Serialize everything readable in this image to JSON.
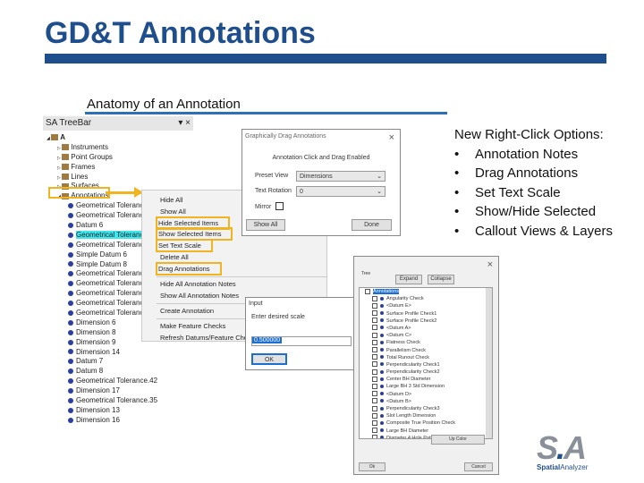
{
  "slide": {
    "title": "GD&T Annotations",
    "subtitle": "Anatomy of an Annotation",
    "notes_heading": "New Right-Click Options:",
    "notes": [
      "Annotation Notes",
      "Drag Annotations",
      "Set Text Scale",
      "Show/Hide Selected",
      "Callout Views & Layers"
    ],
    "accent": "#1f4e8c",
    "highlight": "#f0b420"
  },
  "treebar": {
    "title": "SA TreeBar",
    "pin": "▾ ×",
    "items": [
      {
        "label": "A",
        "level": 0,
        "icon": "folder-icon"
      },
      {
        "label": "Instruments",
        "level": 1,
        "icon": "instrument-icon"
      },
      {
        "label": "Point Groups",
        "level": 1,
        "icon": "point-group-icon"
      },
      {
        "label": "Frames",
        "level": 1,
        "icon": "frame-icon"
      },
      {
        "label": "Lines",
        "level": 1,
        "icon": "line-icon"
      },
      {
        "label": "Surfaces",
        "level": 1,
        "icon": "surface-icon"
      },
      {
        "label": "Annotations",
        "level": 1,
        "icon": "annotation-icon"
      },
      {
        "label": "Geometrical Tolerance.",
        "level": 2
      },
      {
        "label": "Geometrical Tolerance.",
        "level": 2
      },
      {
        "label": "Datum 6",
        "level": 2
      },
      {
        "label": "Geometrical Tolerance.",
        "level": 2,
        "selected": true
      },
      {
        "label": "Geometrical Tolerance.",
        "level": 2
      },
      {
        "label": "Simple Datum 6",
        "level": 2
      },
      {
        "label": "Simple Datum 8",
        "level": 2
      },
      {
        "label": "Geometrical Tolerance.",
        "level": 2
      },
      {
        "label": "Geometrical Tolerance.",
        "level": 2
      },
      {
        "label": "Geometrical Tolerance.",
        "level": 2
      },
      {
        "label": "Geometrical Tolerance.",
        "level": 2
      },
      {
        "label": "Geometrical Tolerance.",
        "level": 2
      },
      {
        "label": "Dimension 6",
        "level": 2
      },
      {
        "label": "Dimension 8",
        "level": 2
      },
      {
        "label": "Dimension 9",
        "level": 2
      },
      {
        "label": "Dimension 14",
        "level": 2
      },
      {
        "label": "Datum 7",
        "level": 2
      },
      {
        "label": "Datum 8",
        "level": 2
      },
      {
        "label": "Geometrical Tolerance.42",
        "level": 2
      },
      {
        "label": "Dimension 17",
        "level": 2
      },
      {
        "label": "Geometrical Tolerance.35",
        "level": 2
      },
      {
        "label": "Dimension 13",
        "level": 2
      },
      {
        "label": "Dimension 16",
        "level": 2
      }
    ]
  },
  "context_menu": {
    "items": [
      {
        "label": "Hide All"
      },
      {
        "label": "Show All"
      },
      {
        "label": "Hide Selected Items",
        "highlight": true
      },
      {
        "label": "Show Selected Items",
        "highlight": true
      },
      {
        "label": "Set Text Scale",
        "highlight": true
      },
      {
        "label": "Delete All"
      },
      {
        "label": "Drag Annotations",
        "highlight": true
      },
      {
        "label": "Hide All Annotation Notes"
      },
      {
        "label": "Show All Annotation Notes"
      },
      {
        "label": "Create Annotation"
      },
      {
        "label": "Make Feature Checks"
      },
      {
        "label": "Refresh Datums/Feature Checks"
      }
    ]
  },
  "drag_dialog": {
    "title": "Graphically Drag Annotations",
    "message": "Annotation Click and Drag Enabled",
    "preset_label": "Preset View",
    "preset_value": "Dimensions",
    "rotation_label": "Text Rotation",
    "rotation_value": "0",
    "mirror_label": "Mirror",
    "show_all": "Show All",
    "done": "Done"
  },
  "input_dialog": {
    "title": "Input",
    "prompt": "Enter desired scale",
    "value": "0.500000",
    "ok": "OK"
  },
  "tree_dialog": {
    "group_label": "Tree",
    "expand": "Expand",
    "collapse": "Collapse",
    "root": "Annotations",
    "items": [
      "Angularity Check",
      "<Datum E>",
      "Surface Profile Check1",
      "Surface Profile Check2",
      "<Datum A>",
      "<Datum C>",
      "Flatness Check",
      "Parallelism Check",
      "Total Runout Check",
      "Perpendicularity Check1",
      "Perpendicularity Check2",
      "Center BH Diameter",
      "Large BH 3 Std Dimension",
      "<Datum D>",
      "<Datum B>",
      "Perpendicularity Check3",
      "Slot Length Dimension",
      "Composite True Position Check",
      "Large BH Diameter",
      "Diameter 4 Hole Pattern"
    ],
    "up_color": "Up Color",
    "ok": "Ok",
    "cancel": "Cancel"
  },
  "logo": {
    "text": "S.A",
    "name": "SpatialAnalyzer"
  }
}
